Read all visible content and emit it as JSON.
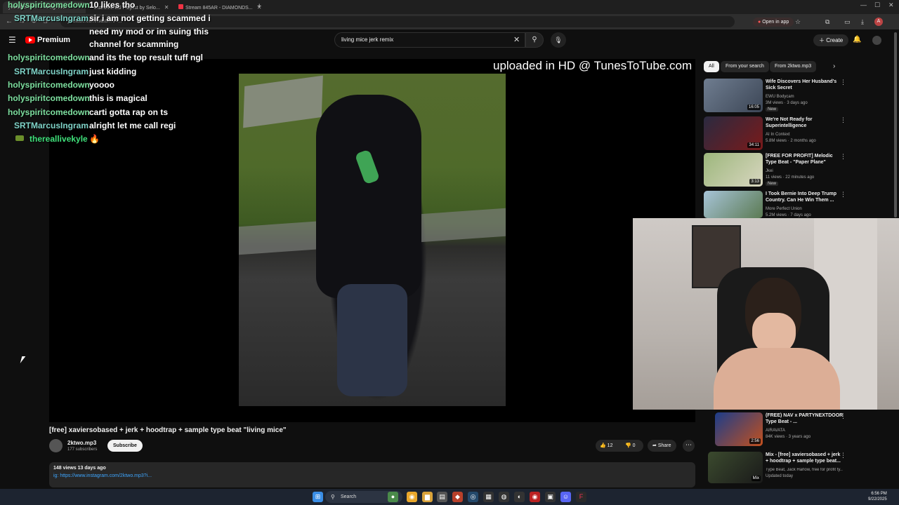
{
  "browser": {
    "tabs": [
      {
        "label": "youtube.com — living mice",
        "active": true
      },
      {
        "label": "Instrumental Playlist by Selo...",
        "active": false
      },
      {
        "label": "Stream 845AR - DIAMONDS...",
        "active": false
      }
    ],
    "url": "youtube.com/watch?v=...",
    "open_in_app": "Open in app"
  },
  "header": {
    "brand": "Premium",
    "search_value": "living mice jerk remix",
    "create_label": "Create"
  },
  "player": {
    "watermark": "uploaded in HD @ TunesToTube.com"
  },
  "chat": [
    {
      "user": "holyspiritcomedown",
      "msg": "10 likes tho"
    },
    {
      "user": "SRTMarcusIngram",
      "msg": "sir i am not getting scammed i"
    },
    {
      "user": "",
      "msg": "need my mod or im suing this"
    },
    {
      "user": "",
      "msg": "channel for scamming"
    },
    {
      "user": "holyspiritcomedown",
      "msg": "and its the top result tuff ngl"
    },
    {
      "user": "SRTMarcusIngram",
      "msg": "just kidding"
    },
    {
      "user": "holyspiritcomedown",
      "msg": "yoooo"
    },
    {
      "user": "holyspiritcomedown",
      "msg": "this is magical"
    },
    {
      "user": "holyspiritcomedown",
      "msg": "carti gotta rap on ts"
    },
    {
      "user": "SRTMarcusIngram",
      "msg": "alright let me call regi"
    },
    {
      "user": "thereallivekyle",
      "msg": "🔥"
    }
  ],
  "chips": [
    "All",
    "From your search",
    "From 2ktwo.mp3"
  ],
  "recommended": [
    {
      "title": "Wife Discovers Her Husband's Sick Secret",
      "channel": "EWU Bodycam",
      "meta": "3M views · 3 days ago",
      "duration": "16:05",
      "badge": "New",
      "colors": [
        "#6f7d90",
        "#3c4656"
      ]
    },
    {
      "title": "We're Not Ready for Superintelligence",
      "channel": "AI In Context",
      "meta": "5.8M views · 2 months ago",
      "duration": "34:11",
      "badge": "",
      "colors": [
        "#2a2a40",
        "#7a1a1a"
      ]
    },
    {
      "title": "[FREE FOR PROFIT] Melodic Type Beat - \"Paper Plane\"",
      "channel": "Jkei",
      "meta": "11 views · 22 minutes ago",
      "duration": "3:13",
      "badge": "New",
      "colors": [
        "#9db77c",
        "#d8d6c0"
      ]
    },
    {
      "title": "I Took Bernie Into Deep Trump Country. Can He Win Them ...",
      "channel": "More Perfect Union",
      "meta": "5.2M views · 7 days ago",
      "duration": "",
      "badge": "",
      "colors": [
        "#a7c4d8",
        "#5b7a52"
      ]
    },
    {
      "title": "(FREE) NAV x PARTYNEXTDOOR Type Beat - ...",
      "channel": "AIRAVATA",
      "meta": "84K views · 3 years ago",
      "duration": "2:56",
      "badge": "",
      "colors": [
        "#1c3d8a",
        "#c2501e"
      ]
    },
    {
      "title": "Mix - [free] xaviersobased + jerk + hoodtrap + sample type beat...",
      "channel": "Type Beat, Jack Harlow, free for profit ty...",
      "meta": "Updated today",
      "duration": "Mix",
      "badge": "",
      "colors": [
        "#3b4a2e",
        "#1a1a1a"
      ]
    }
  ],
  "video": {
    "title": "[free] xaviersobased + jerk + hoodtrap + sample type beat \"living mice\"",
    "channel": "2ktwo.mp3",
    "subscribers": "177 subscribers",
    "subscribe_label": "Subscribe",
    "likes": "12",
    "dislikes": "0",
    "share_label": "Share",
    "desc_meta": "148 views  13 days ago",
    "desc_link": "ig: https://www.instagram.com/2ktwo.mp3?i..."
  },
  "taskbar": {
    "search_label": "Search",
    "time": "6:56 PM",
    "date": "9/22/2025"
  }
}
